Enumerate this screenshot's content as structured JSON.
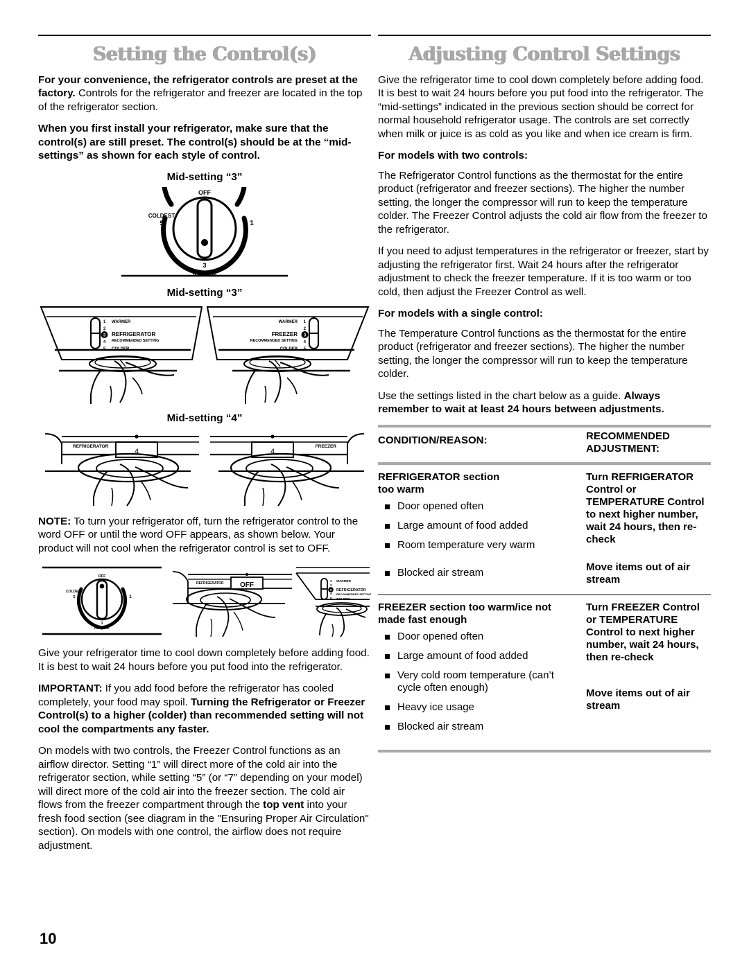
{
  "page": {
    "number": "10"
  },
  "left": {
    "title": "Setting the Control(s)",
    "p1_bold": "For your convenience, the refrigerator controls are preset at the factory.",
    "p1_rest": " Controls for the refrigerator and freezer are located in the top of the refrigerator section.",
    "p2": "When you first install your refrigerator, make sure that the control(s) are still preset. The control(s) should be at the “mid-settings” as shown for each style of control.",
    "label_mid3_dial": "Mid-setting “3”",
    "label_mid3_panel": "Mid-setting “3”",
    "label_mid4_panel": "Mid-setting “4”",
    "dial": {
      "off": "OFF",
      "coldest": "COLDEST",
      "five": "5",
      "one": "1",
      "three": "3",
      "normal": "NORMAL"
    },
    "panel_refrigerator": {
      "n1": "1",
      "n2": "2",
      "n3": "3",
      "n4": "4",
      "n5": "5",
      "warmer": "WARMER",
      "name": "REFRIGERATOR",
      "recommended": "RECOMMENDED SETTING",
      "colder": "COLDER"
    },
    "panel_freezer": {
      "n1": "1",
      "n2": "2",
      "n3": "3",
      "n4": "4",
      "n5": "5",
      "warmer": "WARMER",
      "name": "FREEZER",
      "recommended": "RECOMMENDED SETTING",
      "colder": "COLDER"
    },
    "slider_refrigerator": {
      "label": "REFRIGERATOR",
      "value": "4"
    },
    "slider_freezer": {
      "label": "FREEZER",
      "value": "4"
    },
    "off_slider": {
      "label": "REFRIGERATOR",
      "value": "OFF"
    },
    "note_bold": "NOTE:",
    "note_rest": " To turn your refrigerator off, turn the refrigerator control to the word OFF or until the word OFF appears, as shown below. Your product will not cool when the refrigerator control is set to OFF.",
    "p3": "Give your refrigerator time to cool down completely before adding food. It is best to wait 24 hours before you put food into the refrigerator.",
    "p4_bold1": "IMPORTANT:",
    "p4_mid": " If you add food before the refrigerator has cooled completely, your food may spoil. ",
    "p4_bold2": "Turning the Refrigerator or Freezer Control(s) to a higher (colder) than recommended setting will not cool the compartments any faster.",
    "p5_a": "On models with two controls, the Freezer Control functions as an airflow director. Setting “1” will direct more of the cold air into the refrigerator section, while setting “5” (or “7” depending on your model) will direct more of the cold air into the freezer section. The cold air flows from the freezer compartment through the ",
    "p5_bold": "top vent",
    "p5_b": " into your fresh food section (see diagram in the \"Ensuring Proper Air Circulation\" section). On models with one control, the airflow does not require adjustment."
  },
  "right": {
    "title": "Adjusting Control Settings",
    "p1": "Give the refrigerator time to cool down completely before adding food. It is best to wait 24 hours before you put food into the refrigerator. The “mid-settings” indicated in the previous section should be correct for normal household refrigerator usage. The controls are set correctly when milk or juice is as cold as you like and when ice cream is firm.",
    "h_two": "For models with two controls:",
    "p2": "The Refrigerator Control functions as the thermostat for the entire product (refrigerator and freezer sections). The higher the number setting, the longer the compressor will run to keep the temperature colder. The Freezer Control adjusts the cold air flow from the freezer to the refrigerator.",
    "p3": "If you need to adjust temperatures in the refrigerator or freezer, start by adjusting the refrigerator first. Wait 24 hours after the refrigerator adjustment to check the freezer temperature. If it is too warm or too cold, then adjust the Freezer Control as well.",
    "h_single": "For models with a single control:",
    "p4": "The Temperature Control functions as the thermostat for the entire product (refrigerator and freezer sections). The higher the number setting, the longer the compressor will run to keep the temperature colder.",
    "p5_a": "Use the settings listed in the chart below as a guide. ",
    "p5_bold": "Always remember to wait at least 24 hours between adjustments.",
    "chart": {
      "header_left": "CONDITION/REASON:",
      "header_right_line1": "RECOMMENDED",
      "header_right_line2": "ADJUSTMENT:",
      "rows": [
        {
          "condition_line1": "REFRIGERATOR section",
          "condition_line2": "too warm",
          "bullets": [
            "Door opened often",
            "Large amount of food added",
            "Room temperature very warm"
          ],
          "adjustment": "Turn REFRIGERATOR Control or TEMPERATURE Control to next higher number, wait 24 hours, then re-check",
          "bullets2": [
            "Blocked air stream"
          ],
          "adjustment2": "Move items out of air stream"
        },
        {
          "condition_line1": "FREEZER section too warm/ice not",
          "condition_line2": "made fast enough",
          "bullets": [
            "Door opened often",
            "Large amount of food added",
            "Very cold room temperature (can’t cycle often enough)",
            "Heavy ice usage"
          ],
          "adjustment": "Turn FREEZER Control or TEMPERATURE Control to next higher number, wait 24 hours, then re-check",
          "bullets2": [
            "Blocked air stream"
          ],
          "adjustment2": "Move items out of air stream"
        }
      ]
    }
  }
}
